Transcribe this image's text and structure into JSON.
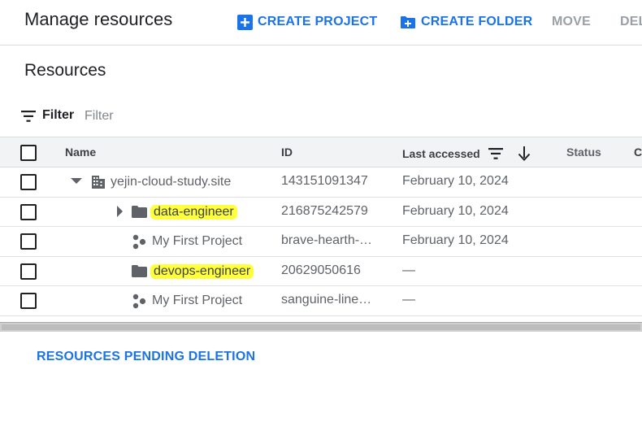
{
  "header": {
    "title": "Manage resources",
    "create_project_label": "CREATE PROJECT",
    "create_folder_label": "CREATE FOLDER",
    "move_label": "MOVE",
    "delete_label": "DEL"
  },
  "section": {
    "title": "Resources"
  },
  "filter": {
    "label": "Filter",
    "placeholder": "Filter"
  },
  "table": {
    "columns": {
      "name": "Name",
      "id": "ID",
      "last_accessed": "Last accessed",
      "status": "Status",
      "more": "C"
    },
    "rows": [
      {
        "name": "yejin-cloud-study.site",
        "id": "143151091347",
        "last_accessed": "February 10, 2024",
        "icon": "organization-icon"
      },
      {
        "name": "data-engineer",
        "id": "216875242579",
        "last_accessed": "February 10, 2024",
        "icon": "folder-icon",
        "highlighted": true
      },
      {
        "name": "My First Project",
        "id": "brave-hearth-…",
        "last_accessed": "February 10, 2024",
        "icon": "project-icon"
      },
      {
        "name": "devops-engineer",
        "id": "20629050616",
        "last_accessed": "—",
        "icon": "folder-icon",
        "highlighted": true
      },
      {
        "name": "My First Project",
        "id": "sanguine-line…",
        "last_accessed": "—",
        "icon": "project-icon"
      }
    ]
  },
  "pending_deletion_label": "RESOURCES PENDING DELETION",
  "colors": {
    "accent": "#1a73e8",
    "highlight": "#ffff3b",
    "disabled": "#9aa0a6"
  }
}
